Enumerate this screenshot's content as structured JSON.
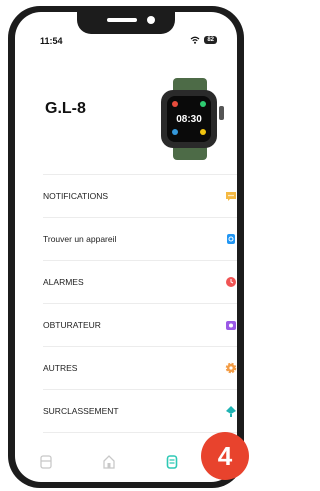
{
  "status_bar": {
    "time": "11:54",
    "battery": "82"
  },
  "device": {
    "name": "G.L-8",
    "watch_display_time": "08:30"
  },
  "menu": [
    {
      "label": "NOTIFICATIONS",
      "icon": "message-icon",
      "color": "#f5b942"
    },
    {
      "label": "Trouver un appareil",
      "icon": "watch-locate-icon",
      "color": "#2196f3"
    },
    {
      "label": "ALARMES",
      "icon": "alarm-clock-icon",
      "color": "#f05454"
    },
    {
      "label": "OBTURATEUR",
      "icon": "camera-icon",
      "color": "#9b59e6"
    },
    {
      "label": "AUTRES",
      "icon": "gear-icon",
      "color": "#f39c45"
    },
    {
      "label": "SURCLASSEMENT",
      "icon": "upgrade-icon",
      "color": "#1fb3b3"
    }
  ],
  "tabbar": {
    "items": [
      "sport-tab-icon",
      "home-tab-icon",
      "device-tab-icon"
    ],
    "active": "device-tab-icon",
    "active_color": "#2ec9b5"
  },
  "step_badge": "4"
}
